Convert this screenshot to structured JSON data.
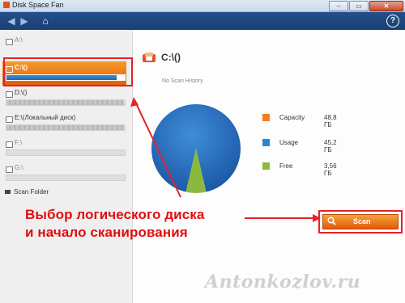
{
  "window": {
    "title": "Disk Space Fan"
  },
  "window_controls": {
    "minimize": "–",
    "maximize": "▭",
    "close": "✕"
  },
  "nav": {
    "back": "◀",
    "forward": "▶",
    "home": "⌂",
    "help": "?"
  },
  "drives": [
    {
      "label": "A:\\",
      "usage_fraction": null,
      "selected": false,
      "dim": true
    },
    {
      "label": "C:\\()",
      "usage_fraction": 0.93,
      "selected": true,
      "dim": false
    },
    {
      "label": "D:\\()",
      "usage_fraction": 0.99,
      "selected": false,
      "dim": false
    },
    {
      "label": "E:\\(Локальный диск)",
      "usage_fraction": 0.99,
      "selected": false,
      "dim": false
    },
    {
      "label": "F:\\",
      "usage_fraction": null,
      "selected": false,
      "dim": true
    },
    {
      "label": "G:\\",
      "usage_fraction": null,
      "selected": false,
      "dim": true
    }
  ],
  "scan_folder": {
    "label": "Scan Folder"
  },
  "content": {
    "drive_title": "C:\\()",
    "no_history": "No Scan History",
    "legend": [
      {
        "name": "Capacity",
        "value": "48,8 ГБ",
        "color": "#f47b20"
      },
      {
        "name": "Usage",
        "value": "45,2 ГБ",
        "color": "#2a86cf"
      },
      {
        "name": "Free",
        "value": "3,56 ГБ",
        "color": "#8cb83e"
      }
    ]
  },
  "chart_data": {
    "type": "pie",
    "labels": [
      "Usage",
      "Free"
    ],
    "values": [
      45.2,
      3.56
    ],
    "colors": [
      "#2a6fb8",
      "#8cb83e"
    ]
  },
  "annotation": {
    "line1": "Выбор логического диска",
    "line2": "и начало сканирования",
    "color": "#e20d0d"
  },
  "scan_button": {
    "label": "Scan"
  },
  "watermark": {
    "text": "Antonkozlov.ru"
  }
}
